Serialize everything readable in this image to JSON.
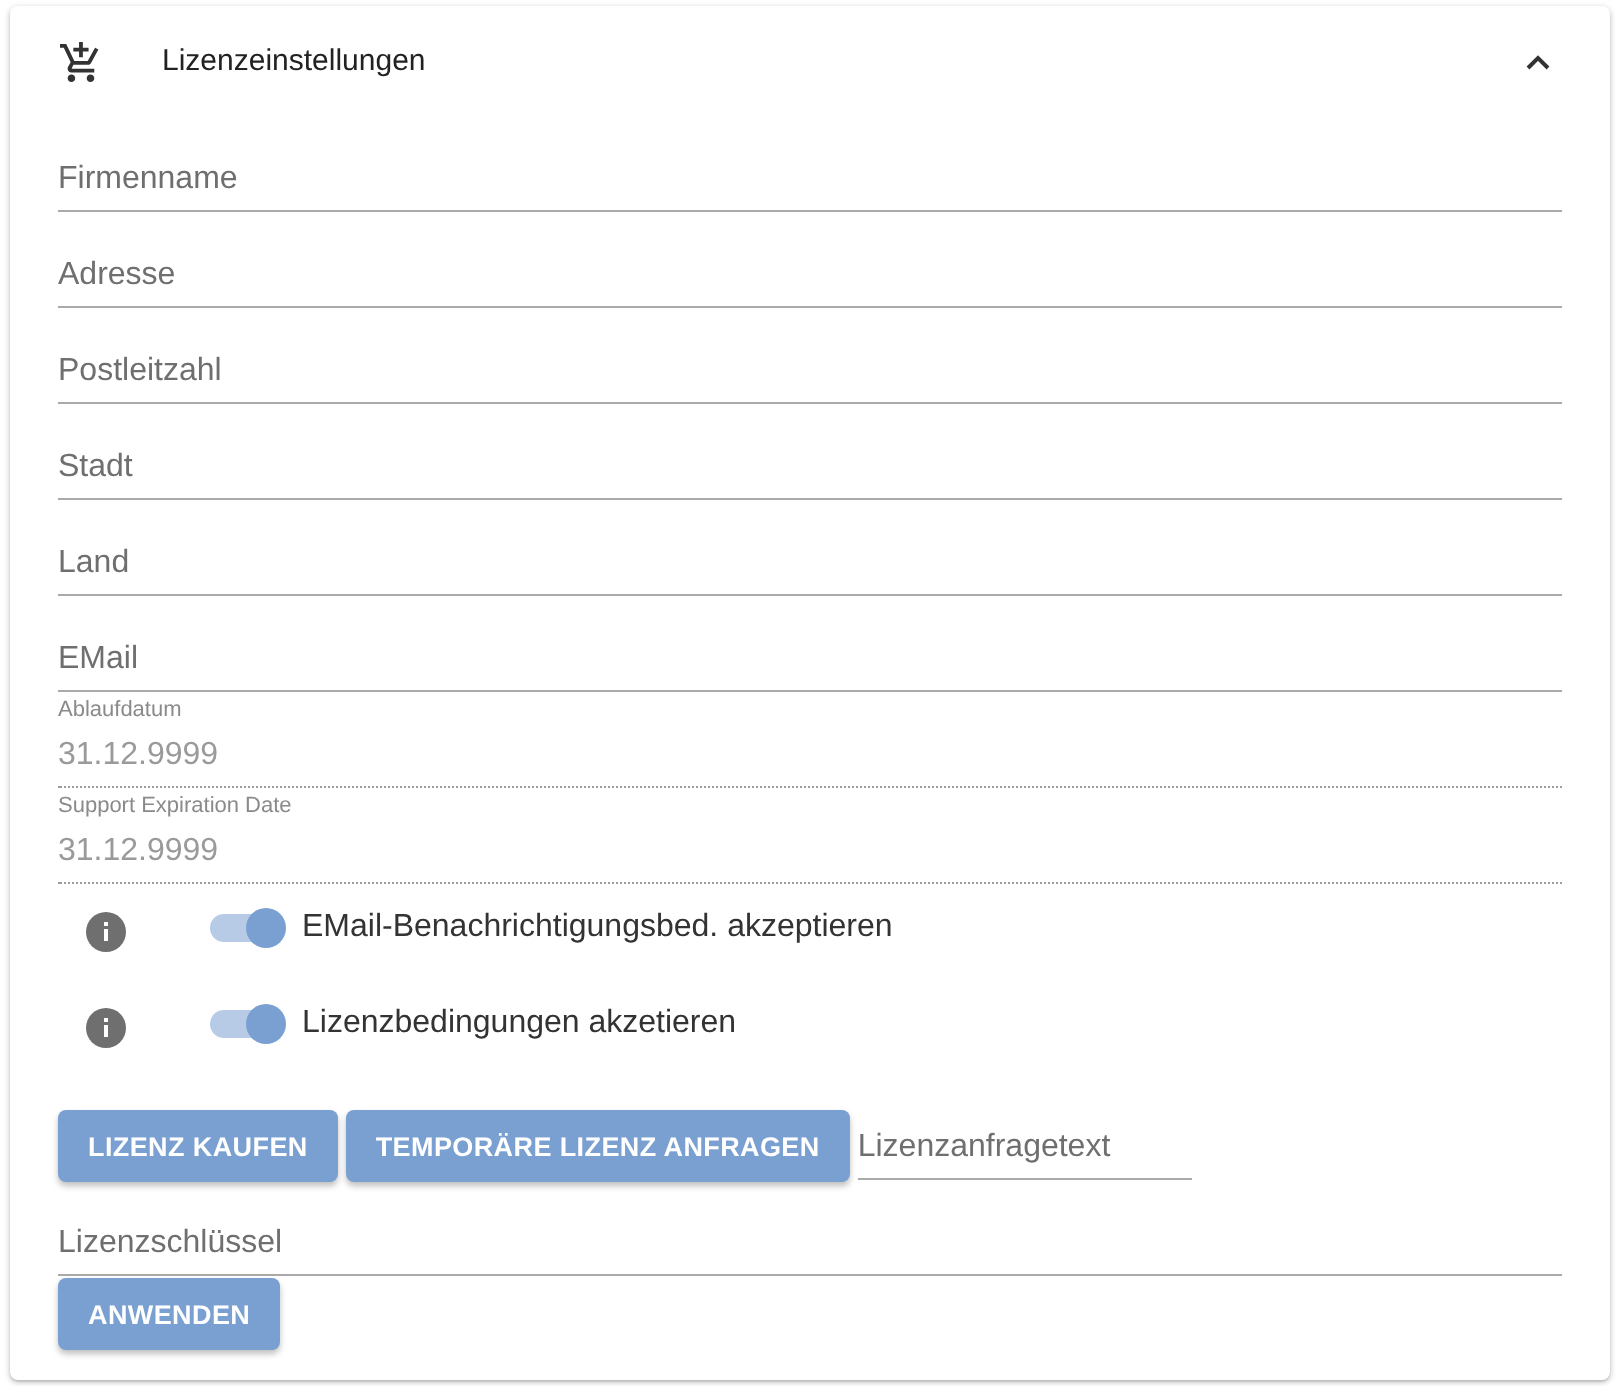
{
  "header": {
    "title": "Lizenzeinstellungen",
    "expanded": true
  },
  "fields": [
    {
      "kind": "text",
      "placeholder": "Firmenname"
    },
    {
      "kind": "text",
      "placeholder": "Adresse"
    },
    {
      "kind": "text",
      "placeholder": "Postleitzahl"
    },
    {
      "kind": "text",
      "placeholder": "Stadt"
    },
    {
      "kind": "text",
      "placeholder": "Land"
    },
    {
      "kind": "text",
      "placeholder": "EMail"
    },
    {
      "kind": "readonly",
      "label": "Ablaufdatum",
      "value": "31.12.9999"
    },
    {
      "kind": "readonly",
      "label": "Support Expiration Date",
      "value": "31.12.9999"
    }
  ],
  "toggles": [
    {
      "label": "EMail-Benachrichtigungsbed. akzeptieren",
      "on": true
    },
    {
      "label": "Lizenzbedingungen akzetieren",
      "on": true
    }
  ],
  "actions": {
    "buttons": [
      "LIZENZ KAUFEN",
      "TEMPORÄRE LIZENZ ANFRAGEN"
    ],
    "request_field": {
      "placeholder": "Lizenzanfragetext"
    }
  },
  "license_key": {
    "placeholder": "Lizenzschlüssel"
  },
  "apply_button": "ANWENDEN"
}
